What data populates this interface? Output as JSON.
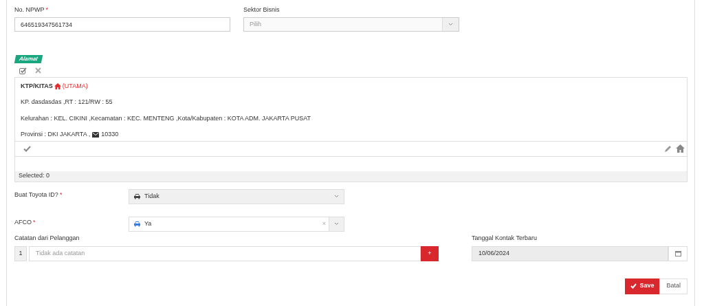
{
  "npwp": {
    "label": "No. NPWP",
    "required_mark": "*",
    "value": "646519347561734"
  },
  "sektor_bisnis": {
    "label": "Sektor Bisnis",
    "placeholder": "Pilih"
  },
  "alamat": {
    "badge": "Alamat",
    "address": {
      "type": "KTP/KITAS",
      "primary_label": "(UTAMA)",
      "primary": true,
      "lines": [
        "KP. dasdasdas ,RT : 121/RW : 55",
        "Kelurahan : KEL. CIKINI ,Kecamatan : KEC. MENTENG ,Kota/Kabupaten : KOTA ADM. JAKARTA PUSAT"
      ],
      "province": "Provinsi : DKI JAKARTA ,",
      "postal_code": "10330"
    },
    "selected_count": "Selected: 0"
  },
  "buat_toyota_id": {
    "label": "Buat Toyota ID?",
    "required_mark": "*",
    "value": "Tidak",
    "disabled": true
  },
  "afco": {
    "label": "AFCO",
    "required_mark": "*",
    "value": "Ya",
    "disabled": false,
    "clear_icon": "×"
  },
  "catatan": {
    "label": "Catatan dari Pelanggan",
    "number": "1",
    "placeholder": "Tidak ada catatan",
    "add_button": "+"
  },
  "tanggal_kontak": {
    "label": "Tanggal Kontak Terbaru",
    "value": "10/06/2024"
  },
  "buttons": [
    {
      "kind": "primary",
      "label": "Save"
    },
    {
      "kind": "secondary",
      "label": "Batal"
    }
  ]
}
